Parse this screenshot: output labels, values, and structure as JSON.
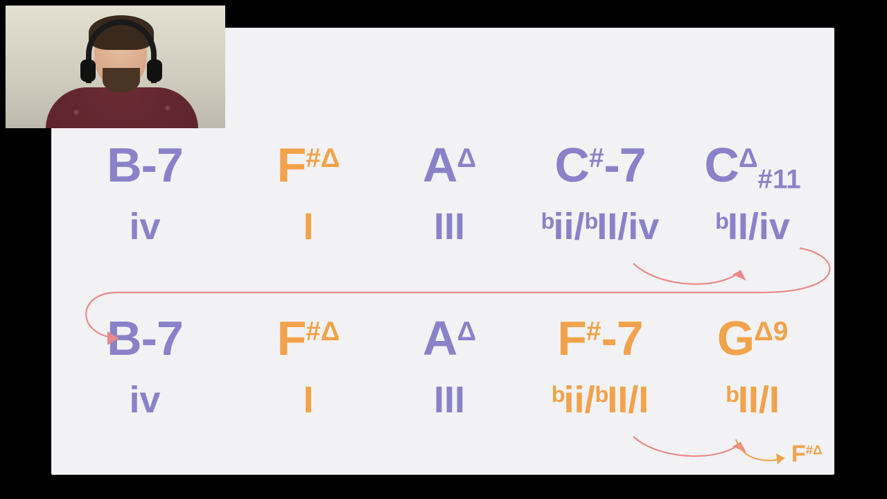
{
  "colors": {
    "purple": "#8b81c8",
    "orange": "#f2a24a",
    "pink": "#e98a8a",
    "slide_bg": "#f2f2f4"
  },
  "row1": {
    "chords": [
      {
        "root": "B",
        "suffix": "-7",
        "sup": "",
        "sub": "",
        "color": "purple"
      },
      {
        "root": "F",
        "suffix": "",
        "sup": "#Δ",
        "sub": "",
        "color": "orange"
      },
      {
        "root": "A",
        "suffix": "",
        "sup": "Δ",
        "sub": "",
        "color": "purple"
      },
      {
        "root": "C",
        "suffix": "-7",
        "sup": "#",
        "sub": "",
        "color": "purple"
      },
      {
        "root": "C",
        "suffix": "",
        "sup": "Δ",
        "sub": "#11",
        "color": "purple"
      }
    ],
    "analysis": [
      {
        "text_html": "iv",
        "color": "purple"
      },
      {
        "text_html": "I",
        "color": "orange"
      },
      {
        "text_html": "III",
        "color": "purple"
      },
      {
        "text_html": "<span class='flat'>b</span>ii/<span class='flat'>b</span>II/iv",
        "color": "purple"
      },
      {
        "text_html": "<span class='flat'>b</span>II/iv",
        "color": "purple"
      }
    ]
  },
  "row2": {
    "chords": [
      {
        "root": "B",
        "suffix": "-7",
        "sup": "",
        "sub": "",
        "color": "purple"
      },
      {
        "root": "F",
        "suffix": "",
        "sup": "#Δ",
        "sub": "",
        "color": "orange"
      },
      {
        "root": "A",
        "suffix": "",
        "sup": "Δ",
        "sub": "",
        "color": "purple"
      },
      {
        "root": "F",
        "suffix": "-7",
        "sup": "#",
        "sub": "",
        "color": "orange"
      },
      {
        "root": "G",
        "suffix": "",
        "sup": "Δ9",
        "sub": "",
        "color": "orange"
      }
    ],
    "analysis": [
      {
        "text_html": "iv",
        "color": "purple"
      },
      {
        "text_html": "I",
        "color": "orange"
      },
      {
        "text_html": "III",
        "color": "purple"
      },
      {
        "text_html": "<span class='flat'>b</span>ii/<span class='flat'>b</span>II/I",
        "color": "orange"
      },
      {
        "text_html": "<span class='flat'>b</span>II/I",
        "color": "orange"
      }
    ]
  },
  "target": {
    "root": "F",
    "sup": "#Δ",
    "color": "orange"
  }
}
